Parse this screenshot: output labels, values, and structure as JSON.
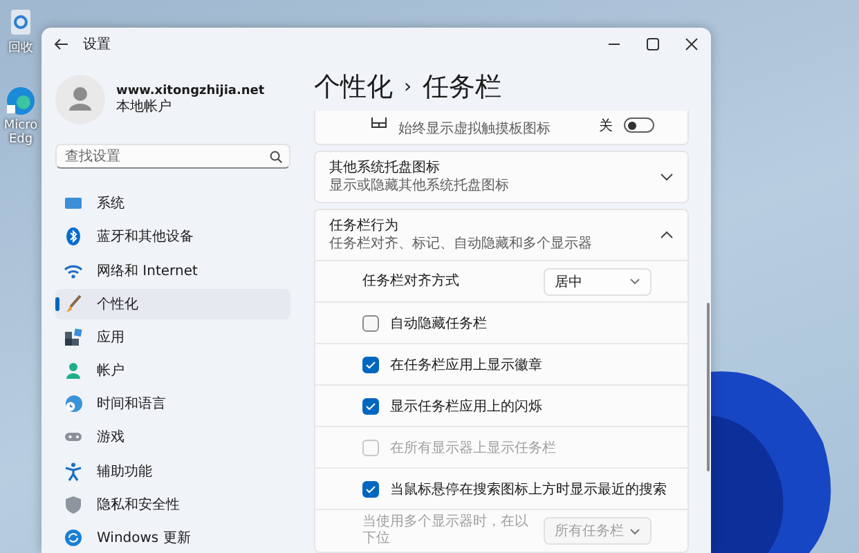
{
  "desktop": {
    "icons": [
      {
        "label": "回收"
      },
      {
        "label": "Micro Edg"
      }
    ]
  },
  "window": {
    "title": "设置"
  },
  "profile": {
    "name": "www.xitongzhijia.net",
    "account_type": "本地帐户"
  },
  "search": {
    "placeholder": "查找设置"
  },
  "sidebar": {
    "items": [
      {
        "label": "系统",
        "selected": false
      },
      {
        "label": "蓝牙和其他设备",
        "selected": false
      },
      {
        "label": "网络和 Internet",
        "selected": false
      },
      {
        "label": "个性化",
        "selected": true
      },
      {
        "label": "应用",
        "selected": false
      },
      {
        "label": "帐户",
        "selected": false
      },
      {
        "label": "时间和语言",
        "selected": false
      },
      {
        "label": "游戏",
        "selected": false
      },
      {
        "label": "辅助功能",
        "selected": false
      },
      {
        "label": "隐私和安全性",
        "selected": false
      },
      {
        "label": "Windows 更新",
        "selected": false
      }
    ]
  },
  "breadcrumb": {
    "parent": "个性化",
    "separator": "›",
    "current": "任务栏"
  },
  "settings": [
    {
      "kind": "toggle",
      "description": "始终显示虚拟触摸板图标",
      "state_label": "关",
      "on": false
    },
    {
      "kind": "expander",
      "title": "其他系统托盘图标",
      "description": "显示或隐藏其他系统托盘图标",
      "expanded": false
    },
    {
      "kind": "expander",
      "title": "任务栏行为",
      "description": "任务栏对齐、标记、自动隐藏和多个显示器",
      "expanded": true,
      "children": [
        {
          "kind": "dropdown",
          "label": "任务栏对齐方式",
          "value": "居中",
          "disabled": false
        },
        {
          "kind": "checkbox",
          "label": "自动隐藏任务栏",
          "checked": false,
          "disabled": false
        },
        {
          "kind": "checkbox",
          "label": "在任务栏应用上显示徽章",
          "checked": true,
          "disabled": false
        },
        {
          "kind": "checkbox",
          "label": "显示任务栏应用上的闪烁",
          "checked": true,
          "disabled": false
        },
        {
          "kind": "checkbox",
          "label": "在所有显示器上显示任务栏",
          "checked": false,
          "disabled": true
        },
        {
          "kind": "checkbox",
          "label": "当鼠标悬停在搜索图标上方时显示最近的搜索",
          "checked": true,
          "disabled": false
        },
        {
          "kind": "dropdown",
          "label": "当使用多个显示器时，在以下位",
          "value": "所有任务栏",
          "disabled": true
        }
      ]
    }
  ]
}
